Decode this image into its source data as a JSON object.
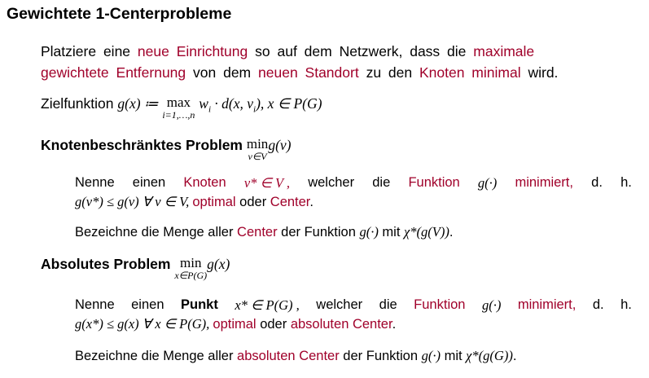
{
  "title": "Gewichtete 1-Centerprobleme",
  "intro": {
    "l1a": "Platziere eine ",
    "l1b": "neue Einrichtung",
    "l1c": " so auf dem Netzwerk, dass die ",
    "l1d": "maximale",
    "l2a": "gewichtete Entfernung",
    "l2b": " von dem ",
    "l2c": "neuen Standort",
    "l2d": " zu den ",
    "l2e": "Knoten minimal",
    "l2f": " wird."
  },
  "ziel": {
    "label": "Zielfunktion",
    "lhs": "g(x) ≔",
    "max": "max",
    "max_sub": "i=1,…,n",
    "rhs": "w",
    "rhs_i": "i",
    "rhs2": " · d(x, v",
    "rhs3": "),  x ∈ P(G)"
  },
  "knoten": {
    "heading": "Knotenbeschränktes Problem",
    "op": "min",
    "op_sub": "v∈V",
    "op_arg": "g(v)",
    "l1": [
      "Nenne",
      "einen",
      "Knoten",
      "v* ∈ V ,",
      "welcher",
      "die",
      "Funktion",
      "g(·)",
      "minimiert,",
      "d.",
      "h."
    ],
    "l2a": "g(v*) ≤ g(v) ∀ v ∈ V, ",
    "l2b": "optimal",
    "l2c": " oder ",
    "l2d": "Center",
    "l2e": ".",
    "l3a": "Bezeichne die Menge aller ",
    "l3b": "Center",
    "l3c": " der Funktion ",
    "l3d": "g(·)",
    "l3e": " mit ",
    "l3f": "χ*(g(V))",
    "l3g": "."
  },
  "absolut": {
    "heading": "Absolutes Problem",
    "op": "min",
    "op_sub": "x∈P(G)",
    "op_arg": "g(x)",
    "l1": [
      "Nenne",
      "einen",
      "Punkt",
      "x* ∈ P(G) ,",
      "welcher",
      "die",
      "Funktion",
      "g(·)",
      "minimiert,",
      "d.",
      "h."
    ],
    "l2a": "g(x*) ≤ g(x) ∀ x ∈ P(G), ",
    "l2b": "optimal",
    "l2c": " oder ",
    "l2d": "absoluten Center",
    "l2e": ".",
    "l3a": "Bezeichne die Menge aller ",
    "l3b": "absoluten Center",
    "l3c": " der Funktion ",
    "l3d": "g(·)",
    "l3e": " mit ",
    "l3f": "χ*(g(G))",
    "l3g": "."
  }
}
